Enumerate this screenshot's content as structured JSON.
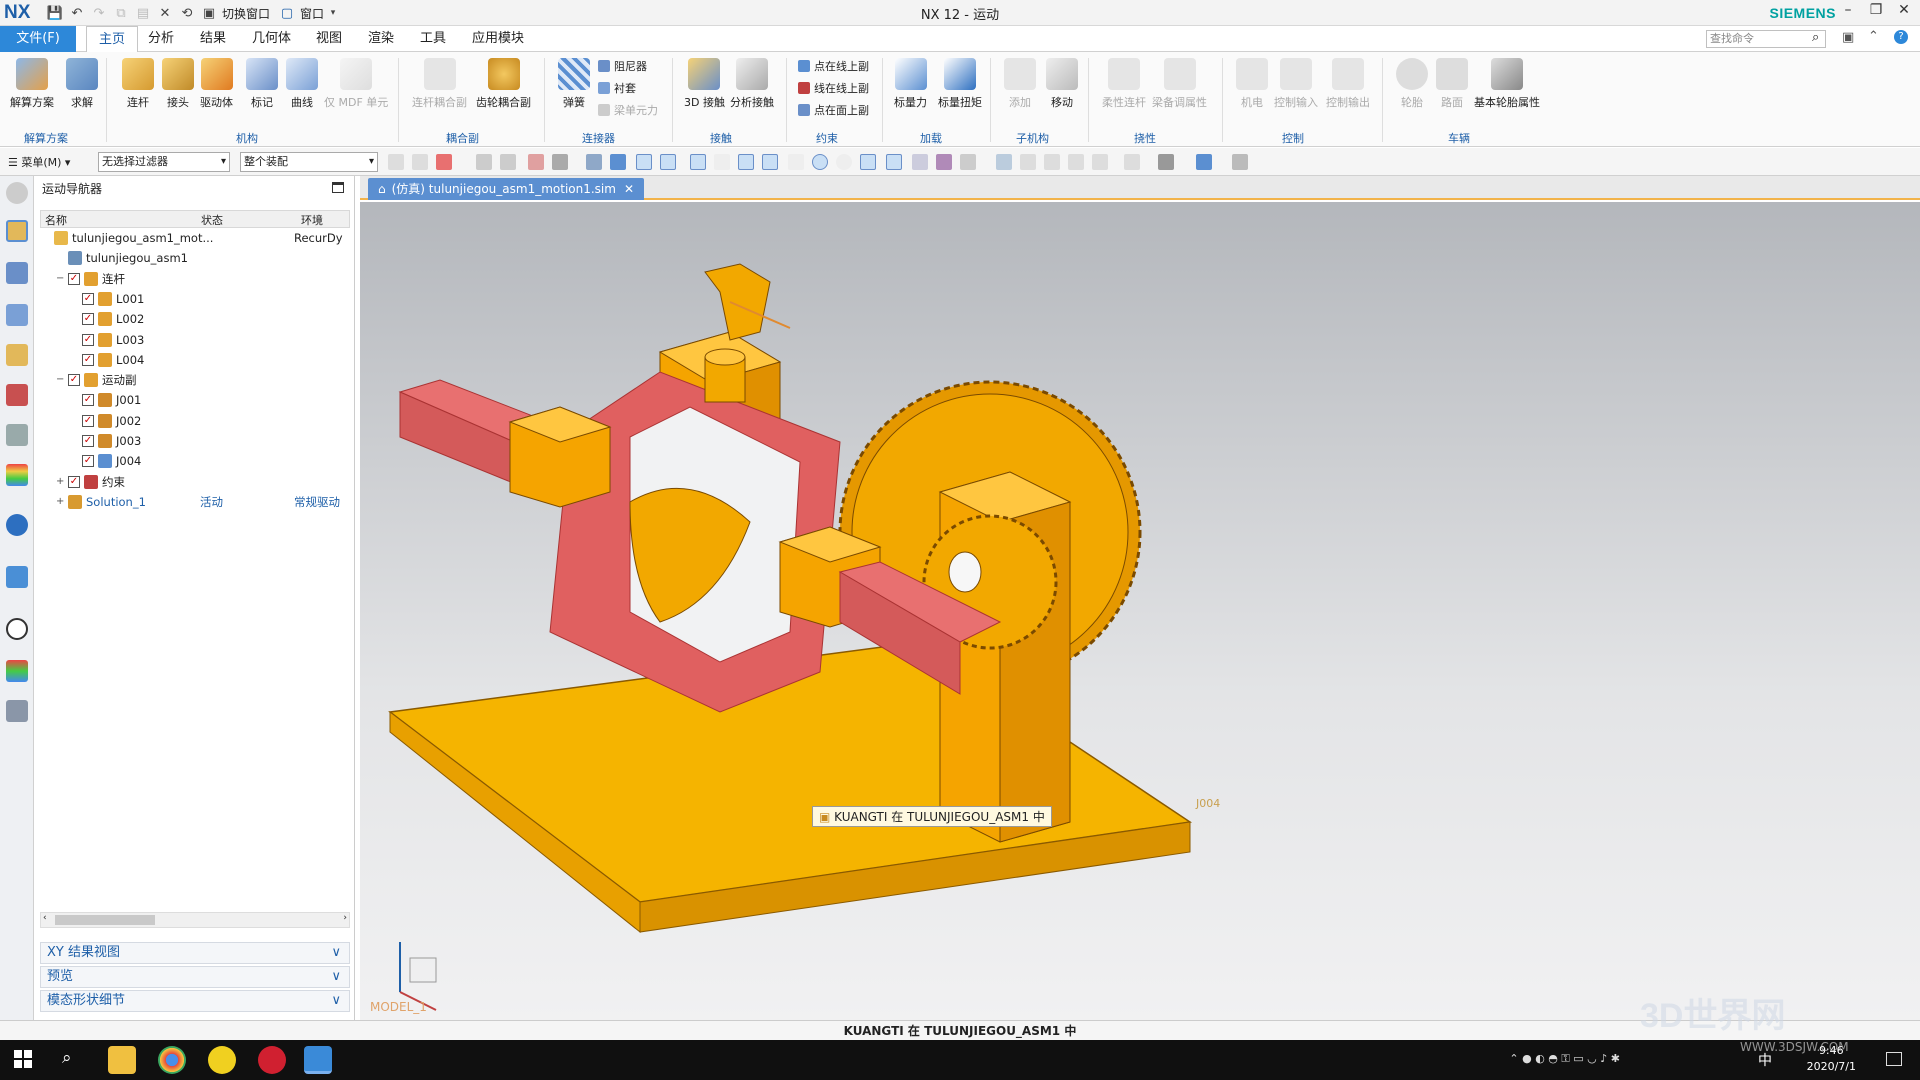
{
  "window": {
    "logo": "NX",
    "title": "NX 12 - 运动",
    "brand": "SIEMENS",
    "switch_window": "切换窗口",
    "window_menu": "窗口"
  },
  "tabs": {
    "file": "文件(F)",
    "items": [
      "主页",
      "分析",
      "结果",
      "几何体",
      "视图",
      "渲染",
      "工具",
      "应用模块"
    ],
    "search_placeholder": "查找命令"
  },
  "ribbon": {
    "solution": {
      "buttons": [
        "解算方案",
        "求解"
      ],
      "group": "解算方案"
    },
    "mechanism": {
      "buttons": [
        "连杆",
        "接头",
        "驱动体",
        "标记",
        "曲线",
        "仅 MDF 单元"
      ],
      "group": "机构"
    },
    "coupler": {
      "buttons": [
        "连杆耦合副",
        "齿轮耦合副"
      ],
      "group": "耦合副"
    },
    "connector": {
      "big": "弹簧",
      "small": [
        "阻尼器",
        "衬套",
        "梁单元力"
      ],
      "group": "连接器"
    },
    "contact": {
      "buttons": [
        "3D 接触",
        "分析接触"
      ],
      "group": "接触"
    },
    "constraint": {
      "small": [
        "点在线上副",
        "线在线上副",
        "点在面上副"
      ],
      "group": "约束"
    },
    "load": {
      "buttons": [
        "标量力",
        "标量扭矩"
      ],
      "group": "加载"
    },
    "submech": {
      "buttons": [
        "添加",
        "移动"
      ],
      "group": "子机构"
    },
    "flex": {
      "buttons": [
        "柔性连杆",
        "梁备调属性"
      ],
      "group": "挠性"
    },
    "control": {
      "buttons": [
        "机电",
        "控制输入",
        "控制输出"
      ],
      "group": "控制"
    },
    "vehicle": {
      "buttons": [
        "轮胎",
        "路面",
        "基本轮胎属性"
      ],
      "group": "车辆"
    }
  },
  "toolbar": {
    "menu": "菜单(M)",
    "filter": "无选择过滤器",
    "assembly": "整个装配"
  },
  "navigator": {
    "title": "运动导航器",
    "columns": [
      "名称",
      "状态",
      "环境"
    ],
    "rows": [
      {
        "name": "tulunjiegou_asm1_mot...",
        "status": "",
        "env": "RecurDy",
        "level": 0,
        "checkbox": false,
        "twisty": "",
        "color": "#e8b84a"
      },
      {
        "name": "tulunjiegou_asm1",
        "status": "",
        "env": "",
        "level": 1,
        "checkbox": false,
        "twisty": "",
        "color": "#6a8fb8"
      },
      {
        "name": "连杆",
        "status": "",
        "env": "",
        "level": 1,
        "checkbox": true,
        "twisty": "−",
        "color": "#e2a030"
      },
      {
        "name": "L001",
        "status": "",
        "env": "",
        "level": 2,
        "checkbox": true,
        "twisty": "",
        "color": "#e2a030"
      },
      {
        "name": "L002",
        "status": "",
        "env": "",
        "level": 2,
        "checkbox": true,
        "twisty": "",
        "color": "#e2a030"
      },
      {
        "name": "L003",
        "status": "",
        "env": "",
        "level": 2,
        "checkbox": true,
        "twisty": "",
        "color": "#e2a030"
      },
      {
        "name": "L004",
        "status": "",
        "env": "",
        "level": 2,
        "checkbox": true,
        "twisty": "",
        "color": "#e2a030"
      },
      {
        "name": "运动副",
        "status": "",
        "env": "",
        "level": 1,
        "checkbox": true,
        "twisty": "−",
        "color": "#e2a030"
      },
      {
        "name": "J001",
        "status": "",
        "env": "",
        "level": 2,
        "checkbox": true,
        "twisty": "",
        "color": "#d08a2a"
      },
      {
        "name": "J002",
        "status": "",
        "env": "",
        "level": 2,
        "checkbox": true,
        "twisty": "",
        "color": "#d08a2a"
      },
      {
        "name": "J003",
        "status": "",
        "env": "",
        "level": 2,
        "checkbox": true,
        "twisty": "",
        "color": "#d08a2a"
      },
      {
        "name": "J004",
        "status": "",
        "env": "",
        "level": 2,
        "checkbox": true,
        "twisty": "",
        "color": "#5b8fd1"
      },
      {
        "name": "约束",
        "status": "",
        "env": "",
        "level": 1,
        "checkbox": true,
        "twisty": "+",
        "color": "#c04040"
      },
      {
        "name": "Solution_1",
        "status": "活动",
        "env": "常规驱动",
        "level": 1,
        "checkbox": false,
        "twisty": "+",
        "color": "#d89a30",
        "link": true
      }
    ],
    "panels": [
      "XY 结果视图",
      "预览",
      "模态形状细节"
    ]
  },
  "document": {
    "tab": "(仿真) tulunjiegou_asm1_motion1.sim",
    "model_label": "MODEL_1",
    "joint_label": "J004",
    "tooltip": "KUANGTI 在 TULUNJIEGOU_ASM1 中"
  },
  "status": {
    "text": "KUANGTI 在 TULUNJIEGOU_ASM1 中"
  },
  "taskbar": {
    "time": "9:46",
    "date": "2020/7/1",
    "ime": "中"
  },
  "watermark": {
    "text": "3D世界网",
    "url": "WWW.3DSJW.COM"
  },
  "colors": {
    "accent": "#2d88d9",
    "part_orange": "#f5a400",
    "frame_red": "#e06060"
  }
}
